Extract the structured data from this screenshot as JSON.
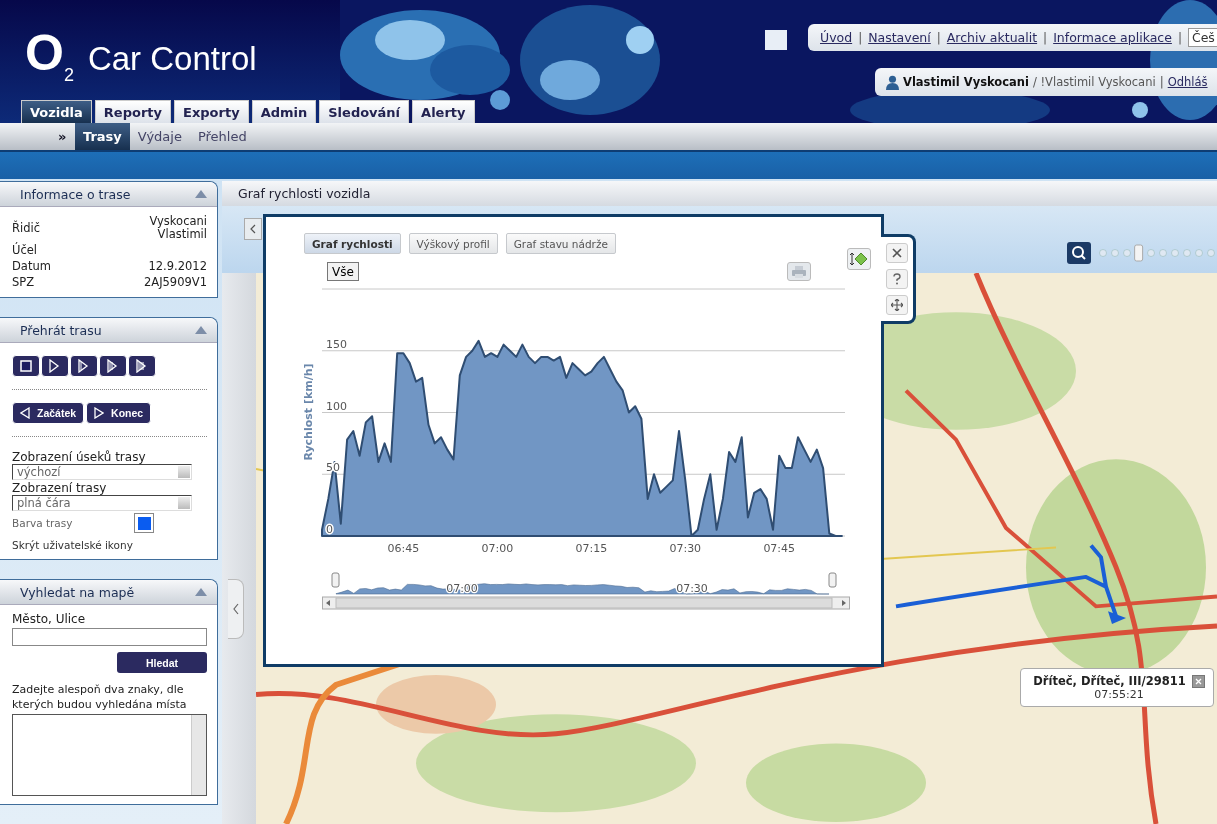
{
  "header": {
    "logo_mark": "O",
    "logo_sub": "2",
    "app_name": "Car Control",
    "separator": "|",
    "top_links": [
      {
        "label": "Úvod"
      },
      {
        "label": "Nastavení"
      },
      {
        "label": "Archiv aktualit"
      },
      {
        "label": "Informace aplikace"
      }
    ],
    "language": "Češ",
    "user": {
      "name": "Vlastimil Vyskocani",
      "account": "/ !Vlastimil Vyskocani",
      "logout": "Odhláš"
    }
  },
  "tabs": [
    {
      "label": "Vozidla",
      "selected": true
    },
    {
      "label": "Reporty",
      "selected": false
    },
    {
      "label": "Exporty",
      "selected": false
    },
    {
      "label": "Admin",
      "selected": false
    },
    {
      "label": "Sledování",
      "selected": false
    },
    {
      "label": "Alerty",
      "selected": false
    }
  ],
  "subnav_marker": "»",
  "subtabs": [
    {
      "label": "Trasy",
      "selected": true
    },
    {
      "label": "Výdaje",
      "selected": false
    },
    {
      "label": "Přehled",
      "selected": false
    }
  ],
  "trip_info": {
    "title": "Informace o trase",
    "rows": [
      {
        "label": "Řidič",
        "value": "Vyskocani Vlastimil"
      },
      {
        "label": "Účel"
      },
      {
        "label": "Datum",
        "value": "12.9.2012"
      },
      {
        "label": "SPZ",
        "value": "2AJ5909V1"
      }
    ]
  },
  "playback": {
    "title": "Přehrát trasu",
    "speed_buttons": [
      {
        "kind": "stop"
      },
      {
        "kind": "play"
      },
      {
        "kind": "play-fast"
      },
      {
        "kind": "play-faster"
      },
      {
        "kind": "play-fastest"
      }
    ],
    "start": "Začátek",
    "end": "Konec",
    "segment_label": "Zobrazení úseků trasy",
    "segment_value": "výchozí",
    "route_label": "Zobrazení trasy",
    "route_value": "plná čára",
    "color_label": "Barva trasy",
    "hide_icons": "Skrýt uživatelské ikony"
  },
  "search": {
    "title": "Vyhledat na mapě",
    "field_label": "Město, Ulice",
    "button": "Hledat",
    "hint": "Zadejte alespoň dva znaky, dle kterých budou vyhledána místa"
  },
  "main": {
    "title": "Graf rychlosti vozidla"
  },
  "chart_popup": {
    "tabs": [
      {
        "label": "Graf rychlosti",
        "selected": true
      },
      {
        "label": "Výškový profil",
        "selected": false
      },
      {
        "label": "Graf stavu nádrže",
        "selected": false
      }
    ],
    "range_button": "Vše",
    "chart_data": {
      "type": "area",
      "ylabel": "Rychlost [km/h]",
      "x": [
        392,
        393,
        394,
        395,
        396,
        397,
        398,
        399,
        400,
        401,
        402,
        403,
        404,
        405,
        406,
        407,
        408,
        409,
        410,
        411,
        412,
        413,
        414,
        415,
        416,
        417,
        418,
        419,
        420,
        421,
        422,
        423,
        424,
        425,
        426,
        427,
        428,
        429,
        430,
        431,
        432,
        433,
        434,
        435,
        436,
        437,
        438,
        439,
        440,
        441,
        442,
        443,
        444,
        445,
        446,
        447,
        448,
        449,
        450,
        451,
        452,
        453,
        454,
        455,
        456,
        457,
        458,
        459,
        460,
        461,
        462,
        463,
        464,
        465,
        466,
        467,
        468,
        469,
        470,
        471,
        472,
        473,
        474,
        475
      ],
      "series": [
        {
          "color": "#7196c4",
          "values": [
            5,
            30,
            60,
            10,
            78,
            85,
            65,
            92,
            97,
            60,
            75,
            60,
            148,
            148,
            140,
            125,
            128,
            90,
            75,
            80,
            70,
            62,
            130,
            145,
            150,
            158,
            145,
            148,
            145,
            155,
            150,
            145,
            155,
            145,
            140,
            145,
            145,
            142,
            145,
            128,
            140,
            135,
            130,
            133,
            140,
            145,
            135,
            125,
            118,
            100,
            105,
            95,
            30,
            50,
            35,
            40,
            45,
            85,
            45,
            0,
            5,
            30,
            50,
            5,
            30,
            68,
            60,
            80,
            15,
            35,
            38,
            30,
            5,
            65,
            55,
            55,
            80,
            70,
            60,
            70,
            55,
            2,
            0,
            0
          ]
        }
      ],
      "xlim": [
        392,
        475.5
      ],
      "ylim": [
        0,
        200
      ],
      "xticks": [
        {
          "value": 405,
          "label": "06:45"
        },
        {
          "value": 420,
          "label": "07:00"
        },
        {
          "value": 435,
          "label": "07:15"
        },
        {
          "value": 450,
          "label": "07:30"
        },
        {
          "value": 465,
          "label": "07:45"
        }
      ],
      "yticks": [
        0,
        50,
        100,
        150
      ],
      "grid": true
    },
    "navigator": {
      "labels": [
        "07:00",
        "07:30"
      ]
    }
  },
  "map_zoom": {
    "level": 0.33
  },
  "map": {
    "kind": "picture",
    "tooltip": {
      "title": "Dříteč, Dříteč, III/29811",
      "time": "07:55:21"
    }
  }
}
